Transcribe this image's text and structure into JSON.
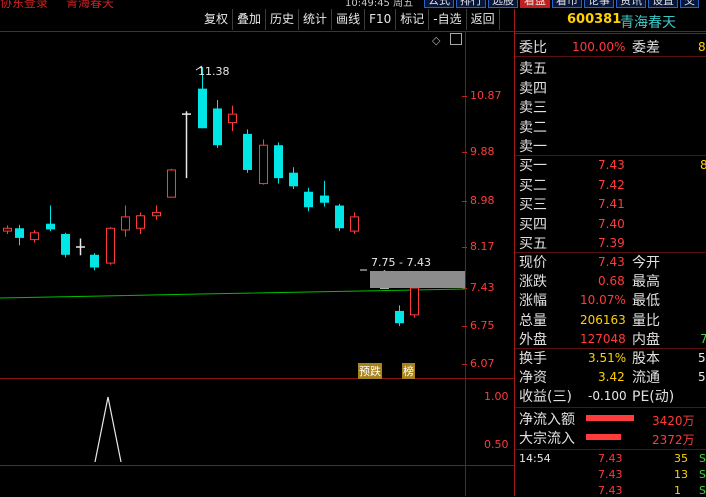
{
  "top_strip": {
    "title_left": "协东登录",
    "stock_left": "青海春天",
    "time_text": "10:49:45 周五",
    "buttons": [
      "公式",
      "排行",
      "选股",
      "看盘",
      "看市",
      "论事",
      "资讯",
      "设置",
      "交"
    ]
  },
  "toolbar": {
    "items": [
      "复权",
      "叠加",
      "历史",
      "统计",
      "画线",
      "F10",
      "标记",
      "-自选",
      "返回"
    ]
  },
  "stock": {
    "code": "600381",
    "name": "青海春天"
  },
  "chart": {
    "price_axis": [
      "10.87",
      "9.88",
      "8.98",
      "8.17",
      "7.43",
      "6.75",
      "6.07"
    ],
    "indicator_axis": [
      "1.00",
      "0.50"
    ],
    "high_label": "11.38",
    "range_label": "7.75 - 7.43",
    "marker_down": "预跌",
    "marker_up": "榜",
    "candles": [
      {
        "o": 8.45,
        "c": 8.5,
        "h": 8.55,
        "l": 8.4
      },
      {
        "o": 8.5,
        "c": 8.33,
        "h": 8.56,
        "l": 8.2
      },
      {
        "o": 8.3,
        "c": 8.42,
        "h": 8.47,
        "l": 8.25
      },
      {
        "o": 8.58,
        "c": 8.48,
        "h": 8.9,
        "l": 8.45
      },
      {
        "o": 8.4,
        "c": 8.03,
        "h": 8.42,
        "l": 7.98
      },
      {
        "o": 8.15,
        "c": 8.17,
        "h": 8.32,
        "l": 8.02
      },
      {
        "o": 8.03,
        "c": 7.8,
        "h": 8.06,
        "l": 7.75
      },
      {
        "o": 7.88,
        "c": 8.5,
        "h": 8.52,
        "l": 7.85
      },
      {
        "o": 8.47,
        "c": 8.7,
        "h": 8.9,
        "l": 8.35
      },
      {
        "o": 8.5,
        "c": 8.72,
        "h": 8.78,
        "l": 8.4
      },
      {
        "o": 8.72,
        "c": 8.78,
        "h": 8.9,
        "l": 8.65
      },
      {
        "o": 9.05,
        "c": 9.55,
        "h": 9.57,
        "l": 9.05
      },
      {
        "o": 10.55,
        "c": 10.55,
        "h": 10.6,
        "l": 9.4
      },
      {
        "o": 11.0,
        "c": 10.3,
        "h": 11.38,
        "l": 10.3
      },
      {
        "o": 10.65,
        "c": 10.0,
        "h": 10.8,
        "l": 9.95
      },
      {
        "o": 10.4,
        "c": 10.55,
        "h": 10.7,
        "l": 10.25
      },
      {
        "o": 10.2,
        "c": 9.55,
        "h": 10.28,
        "l": 9.5
      },
      {
        "o": 9.3,
        "c": 10.0,
        "h": 10.1,
        "l": 9.28
      },
      {
        "o": 10.0,
        "c": 9.4,
        "h": 10.05,
        "l": 9.3
      },
      {
        "o": 9.5,
        "c": 9.25,
        "h": 9.6,
        "l": 9.2
      },
      {
        "o": 9.15,
        "c": 8.87,
        "h": 9.22,
        "l": 8.8
      },
      {
        "o": 9.08,
        "c": 8.95,
        "h": 9.35,
        "l": 8.88
      },
      {
        "o": 8.9,
        "c": 8.5,
        "h": 8.93,
        "l": 8.45
      },
      {
        "o": 8.45,
        "c": 8.7,
        "h": 8.78,
        "l": 8.4
      },
      {
        "o": 7.43,
        "c": 7.43,
        "h": 7.75,
        "l": 7.43
      },
      {
        "o": 7.02,
        "c": 6.8,
        "h": 7.12,
        "l": 6.75
      },
      {
        "o": 6.95,
        "c": 7.43,
        "h": 7.45,
        "l": 6.9
      }
    ]
  },
  "panel": {
    "weibi": {
      "label": "委比",
      "value": "100.00%",
      "label2": "委差",
      "value2": "8"
    },
    "asks": [
      {
        "label": "卖五",
        "price": ""
      },
      {
        "label": "卖四",
        "price": ""
      },
      {
        "label": "卖三",
        "price": ""
      },
      {
        "label": "卖二",
        "price": ""
      },
      {
        "label": "卖一",
        "price": ""
      }
    ],
    "bids": [
      {
        "label": "买一",
        "price": "7.43",
        "vol": "8"
      },
      {
        "label": "买二",
        "price": "7.42",
        "vol": ""
      },
      {
        "label": "买三",
        "price": "7.41",
        "vol": ""
      },
      {
        "label": "买四",
        "price": "7.40",
        "vol": ""
      },
      {
        "label": "买五",
        "price": "7.39",
        "vol": ""
      }
    ],
    "quote": [
      {
        "l1": "现价",
        "v1": "7.43",
        "l2": "今开"
      },
      {
        "l1": "涨跌",
        "v1": "0.68",
        "l2": "最高"
      },
      {
        "l1": "涨幅",
        "v1": "10.07%",
        "l2": "最低"
      },
      {
        "l1": "总量",
        "v1": "206163",
        "l2": "量比"
      },
      {
        "l1": "外盘",
        "v1": "127048",
        "l2": "内盘",
        "v2": "7"
      }
    ],
    "fund": [
      {
        "l1": "换手",
        "v1": "3.51%",
        "l2": "股本",
        "v2": "5"
      },
      {
        "l1": "净资",
        "v1": "3.42",
        "l2": "流通",
        "v2": "5"
      },
      {
        "l1": "收益(三)",
        "v1": "-0.100",
        "l2": "PE(动)"
      }
    ],
    "flow": [
      {
        "label": "净流入额",
        "value": "3420万",
        "bar": 0.95
      },
      {
        "label": "大宗流入",
        "value": "2372万",
        "bar": 0.7
      }
    ],
    "ticks": [
      {
        "time": "14:54",
        "price": "7.43",
        "vol": "35",
        "flag": "S"
      },
      {
        "time": "",
        "price": "7.43",
        "vol": "13",
        "flag": "S"
      },
      {
        "time": "",
        "price": "7.43",
        "vol": "1",
        "flag": "S"
      }
    ]
  },
  "colors": {
    "up": "#ff3b3b",
    "down": "#00e5e5",
    "ma": "#00c000",
    "grid": "#8b1313"
  }
}
